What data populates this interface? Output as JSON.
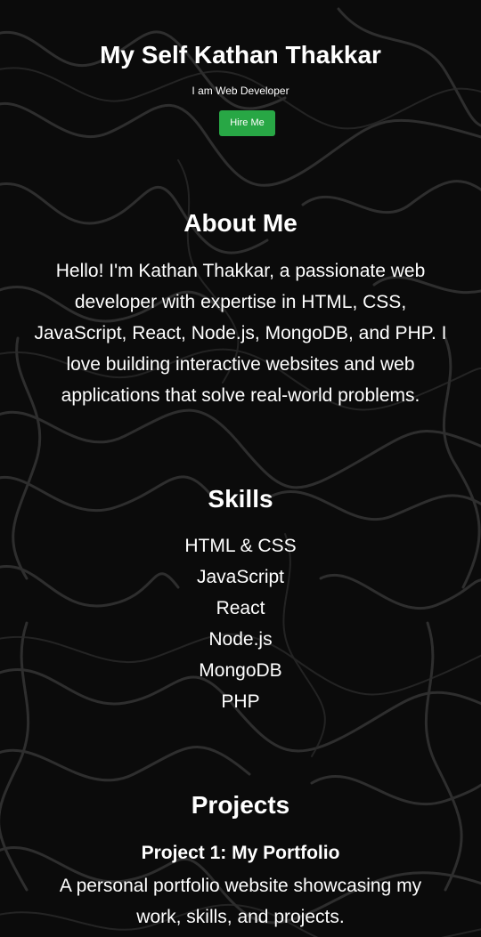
{
  "hero": {
    "title": "My Self Kathan Thakkar",
    "subtitle": "I am Web Developer",
    "button_label": "Hire Me"
  },
  "about": {
    "heading": "About Me",
    "text": "Hello! I'm Kathan Thakkar, a passionate web developer with expertise in HTML, CSS, JavaScript, React, Node.js, MongoDB, and PHP. I love building interactive websites and web applications that solve real-world problems."
  },
  "skills": {
    "heading": "Skills",
    "items": [
      "HTML & CSS",
      "JavaScript",
      "React",
      "Node.js",
      "MongoDB",
      "PHP"
    ]
  },
  "projects": {
    "heading": "Projects",
    "items": [
      {
        "title": "Project 1: My Portfolio",
        "description": "A personal portfolio website showcasing my work, skills, and projects."
      }
    ]
  },
  "colors": {
    "background": "#0b0b0b",
    "button": "#28a745",
    "text": "#ffffff"
  }
}
